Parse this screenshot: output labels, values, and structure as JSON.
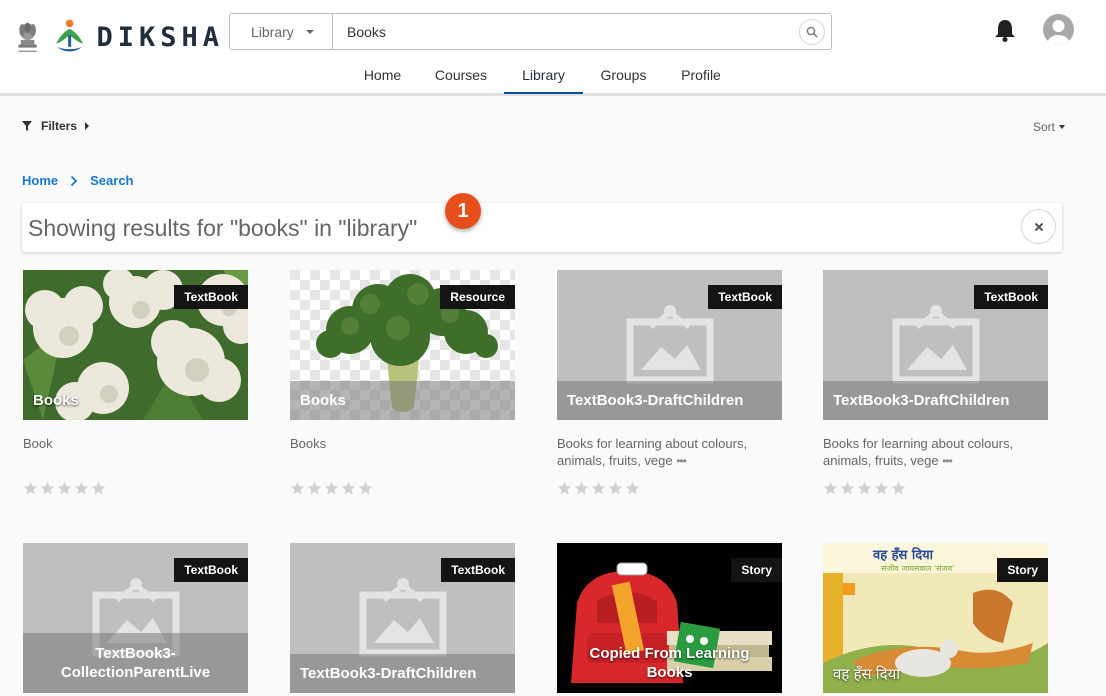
{
  "header": {
    "brand": "DIKSHA",
    "search_category": "Library",
    "search_value": "Books",
    "nav": [
      {
        "label": "Home"
      },
      {
        "label": "Courses"
      },
      {
        "label": "Library"
      },
      {
        "label": "Groups"
      },
      {
        "label": "Profile"
      }
    ],
    "active_nav": "Library"
  },
  "toolbar": {
    "filters_label": "Filters",
    "sort_label": "Sort"
  },
  "breadcrumb": {
    "home": "Home",
    "current": "Search"
  },
  "results": {
    "text": "Showing results for \"books\" in \"library\"",
    "step_number": "1"
  },
  "cards": [
    {
      "badge": "TextBook",
      "title": "Books",
      "desc": "Book",
      "rating": 0,
      "image": "cauliflower"
    },
    {
      "badge": "Resource",
      "title": "Books",
      "desc": "Books",
      "rating": 0,
      "image": "broccoli"
    },
    {
      "badge": "TextBook",
      "title": "TextBook3-DraftChildren",
      "desc": "Books for learning about colours, animals, fruits, vege",
      "rating": 0,
      "image": "placeholder"
    },
    {
      "badge": "TextBook",
      "title": "TextBook3-DraftChildren",
      "desc": "Books for learning about colours, animals, fruits, vege",
      "rating": 0,
      "image": "placeholder"
    },
    {
      "badge": "TextBook",
      "title": "TextBook3-CollectionParentLive",
      "desc": "",
      "rating": 0,
      "image": "placeholder"
    },
    {
      "badge": "TextBook",
      "title": "TextBook3-DraftChildren",
      "desc": "",
      "rating": 0,
      "image": "placeholder"
    },
    {
      "badge": "Story",
      "title": "Copied From Learning Books",
      "desc": "",
      "rating": 0,
      "image": "school-bag"
    },
    {
      "badge": "Story",
      "title": "वह हँस दिया",
      "desc": "",
      "rating": 0,
      "image": "deer-story"
    }
  ],
  "colors": {
    "accent": "#024f9d",
    "link": "#1877d3",
    "step_badge": "#e84e1b",
    "card_badge_bg": "#141414"
  }
}
